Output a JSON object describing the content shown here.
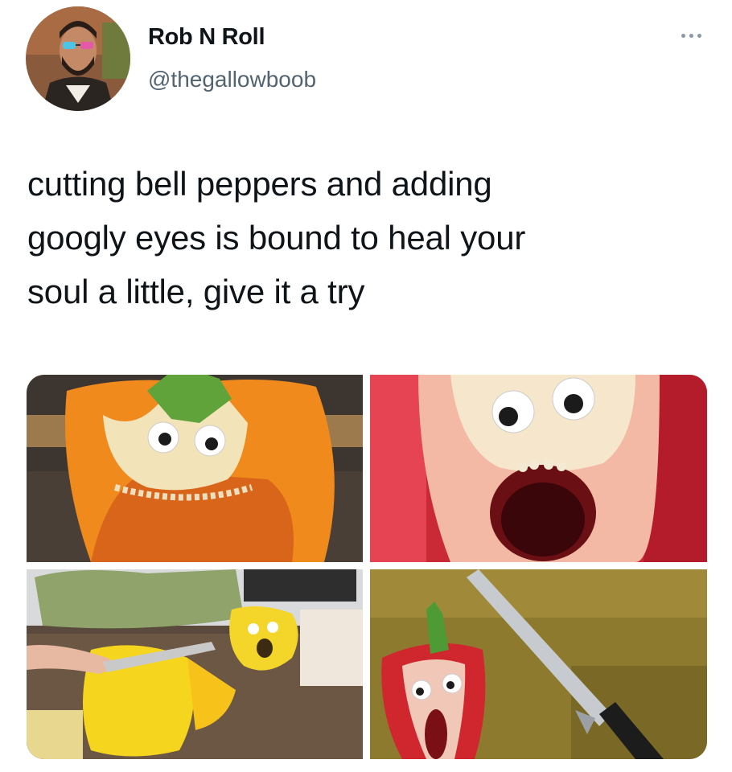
{
  "tweet": {
    "user": {
      "name": "Rob N Roll",
      "handle": "@thegallowboob",
      "avatar_icon": "profile-avatar"
    },
    "more_icon": "more-horizontal-icon",
    "text_lines": [
      "cutting bell peppers and adding",
      "googly eyes is bound to heal your",
      "soul a little, give it a try"
    ],
    "media": [
      {
        "subject": "orange bell pepper with googly eyes"
      },
      {
        "subject": "red bell pepper with googly eyes and open mouth"
      },
      {
        "subject": "yellow bell pepper being cut, with googly eyes"
      },
      {
        "subject": "red bell pepper half with googly eyes beside a knife"
      }
    ]
  },
  "colors": {
    "text": "#0f1419",
    "secondary_text": "#536471",
    "background": "#ffffff"
  }
}
